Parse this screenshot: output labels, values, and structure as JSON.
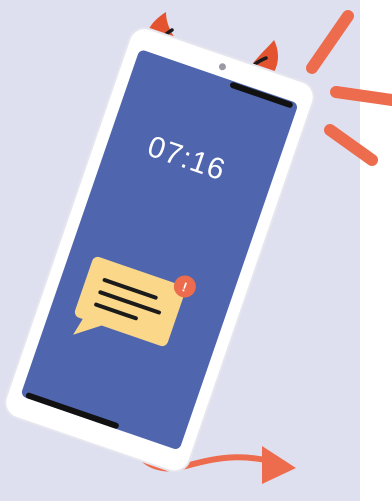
{
  "phone": {
    "clock_time": "07:16",
    "notification_badge": "!"
  },
  "colors": {
    "background_panel": "#dfe0ef",
    "phone_frame": "#ffffff",
    "phone_screen": "#4f65ae",
    "horns": "#e4532f",
    "tail": "#ec6c4d",
    "alarm_lines": "#ec6c4d",
    "message_bubble": "#fbd78a",
    "badge": "#ec6c4d",
    "outline": "#1b1b1b"
  }
}
